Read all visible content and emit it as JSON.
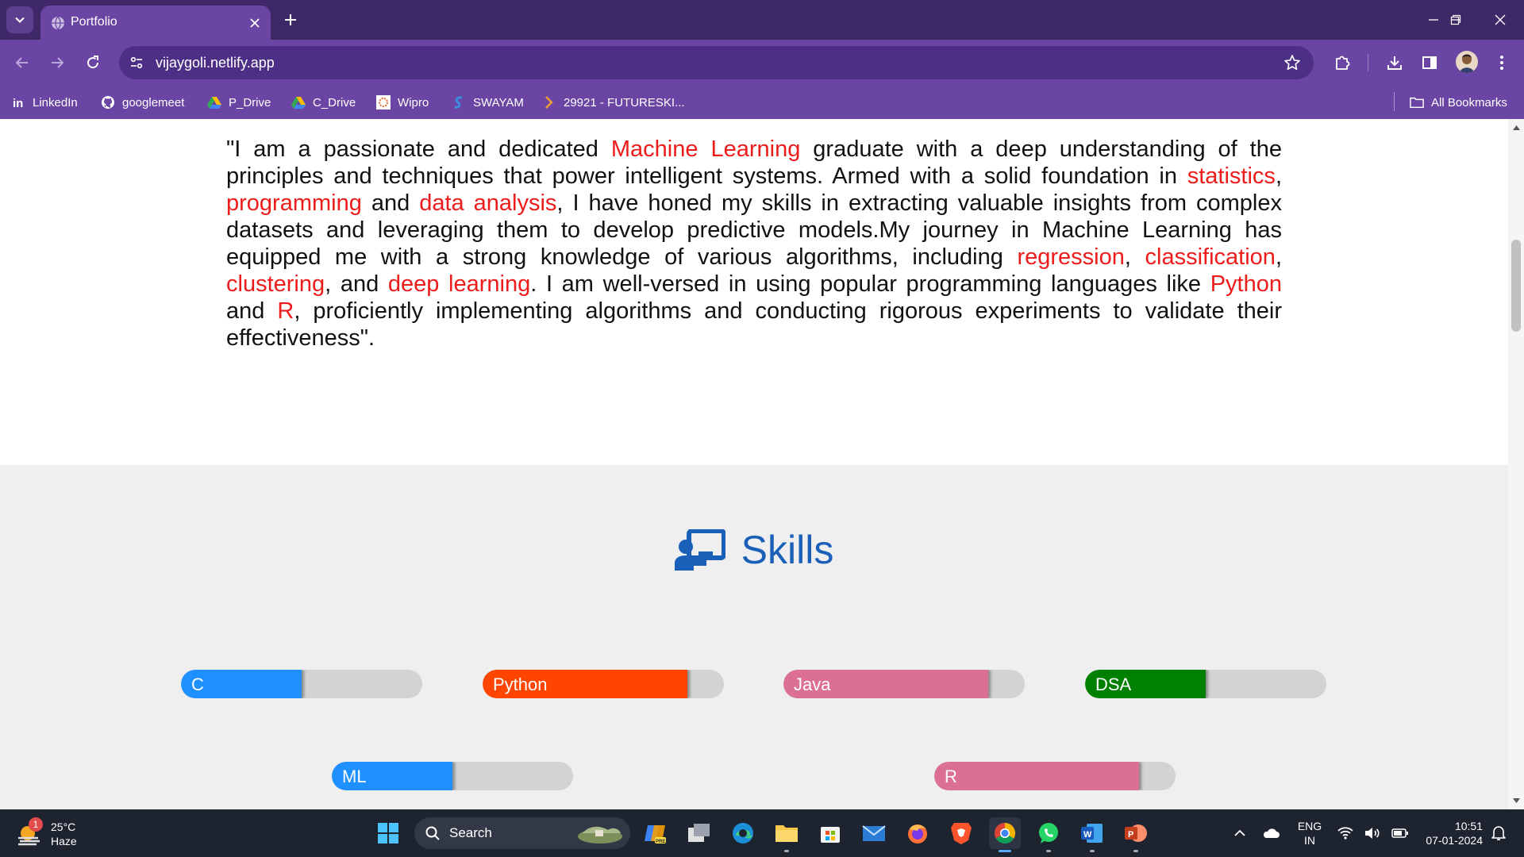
{
  "browser": {
    "tab_title": "Portfolio",
    "url": "vijaygoli.netlify.app",
    "bookmarks": [
      {
        "label": "LinkedIn",
        "icon": "linkedin-icon"
      },
      {
        "label": "googlemeet",
        "icon": "github-icon"
      },
      {
        "label": "P_Drive",
        "icon": "google-drive-icon"
      },
      {
        "label": "C_Drive",
        "icon": "google-drive-icon"
      },
      {
        "label": "Wipro",
        "icon": "wipro-icon"
      },
      {
        "label": "SWAYAM",
        "icon": "swayam-icon"
      },
      {
        "label": "29921 - FUTURESKI...",
        "icon": "chevron-right-icon"
      }
    ],
    "all_bookmarks_label": "All Bookmarks",
    "colors": {
      "frame": "#3f2868",
      "toolbar": "#6b45a3",
      "omnibox": "#4e2f86"
    }
  },
  "about": {
    "segments": [
      {
        "text": "\"I am a passionate and dedicated ",
        "highlight": false
      },
      {
        "text": "Machine Learning",
        "highlight": true
      },
      {
        "text": " graduate with a deep understanding of the principles and techniques that power intelligent systems. Armed with a solid foundation in ",
        "highlight": false
      },
      {
        "text": "statistics",
        "highlight": true
      },
      {
        "text": ", ",
        "highlight": false
      },
      {
        "text": "programming",
        "highlight": true
      },
      {
        "text": " and ",
        "highlight": false
      },
      {
        "text": "data analysis",
        "highlight": true
      },
      {
        "text": ", I have honed my skills in extracting valuable insights from complex datasets and leveraging them to develop predictive models.My journey in Machine Learning has equipped me with a strong knowledge of various algorithms, including ",
        "highlight": false
      },
      {
        "text": "regression",
        "highlight": true
      },
      {
        "text": ", ",
        "highlight": false
      },
      {
        "text": "classification",
        "highlight": true
      },
      {
        "text": ", ",
        "highlight": false
      },
      {
        "text": "clustering",
        "highlight": true
      },
      {
        "text": ", and ",
        "highlight": false
      },
      {
        "text": "deep learning",
        "highlight": true
      },
      {
        "text": ". I am well-versed in using popular programming languages like ",
        "highlight": false
      },
      {
        "text": "Python",
        "highlight": true
      },
      {
        "text": " and ",
        "highlight": false
      },
      {
        "text": "R",
        "highlight": true
      },
      {
        "text": ", proficiently implementing algorithms and conducting rigorous experiments to validate their effectiveness\".",
        "highlight": false
      }
    ],
    "highlight_color": "#ee1b1b"
  },
  "skills": {
    "title": "Skills",
    "title_color": "#1a5fb8",
    "icon": "teacher-presentation-icon",
    "items": [
      {
        "name": "C",
        "level": 0.5,
        "color": "#1e90ff"
      },
      {
        "name": "Python",
        "level": 0.85,
        "color": "#ff4500"
      },
      {
        "name": "Java",
        "level": 0.85,
        "color": "#db7093"
      },
      {
        "name": "DSA",
        "level": 0.5,
        "color": "#008000"
      },
      {
        "name": "ML",
        "level": 0.5,
        "color": "#1e90ff"
      },
      {
        "name": "R",
        "level": 0.85,
        "color": "#db7093"
      }
    ]
  },
  "taskbar": {
    "weather": {
      "badge": "1",
      "temp": "25°C",
      "condition": "Haze"
    },
    "search_placeholder": "Search",
    "apps": [
      "start-icon",
      "copilot-icon",
      "task-view-icon",
      "edge-icon",
      "file-explorer-icon",
      "microsoft-store-icon",
      "mail-icon",
      "firefox-icon",
      "brave-icon",
      "chrome-icon",
      "whatsapp-icon",
      "word-icon",
      "powerpoint-icon"
    ],
    "lang_line1": "ENG",
    "lang_line2": "IN",
    "time": "10:51",
    "date": "07-01-2024"
  }
}
